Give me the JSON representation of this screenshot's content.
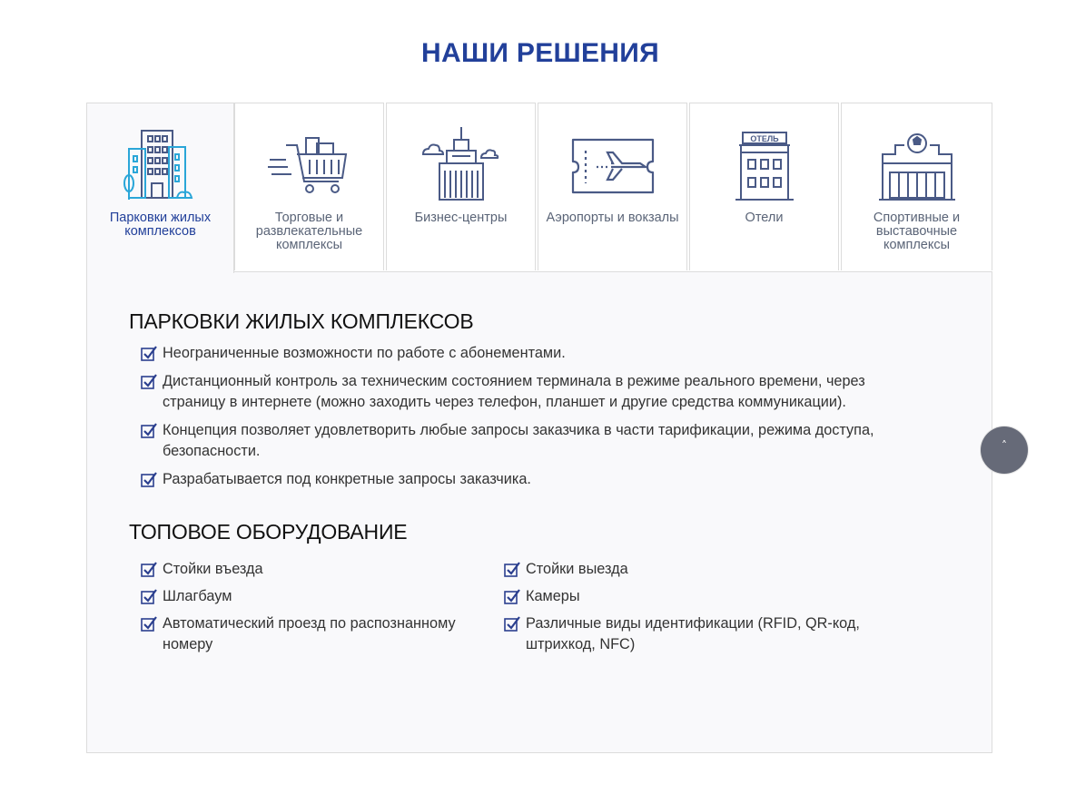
{
  "section_title": "НАШИ РЕШЕНИЯ",
  "tabs": [
    {
      "label": "Парковки жилых комплексов",
      "icon": "residential-building-icon",
      "active": true
    },
    {
      "label": "Торговые и развлекательные комплексы",
      "icon": "shopping-cart-icon",
      "active": false
    },
    {
      "label": "Бизнес-центры",
      "icon": "business-center-icon",
      "active": false
    },
    {
      "label": "Аэропорты и вокзалы",
      "icon": "plane-ticket-icon",
      "active": false
    },
    {
      "label": "Отели",
      "icon": "hotel-icon",
      "active": false,
      "icon_sign": "ОТЕЛЬ"
    },
    {
      "label": "Спортивные и выставочные комплексы",
      "icon": "stadium-icon",
      "active": false
    }
  ],
  "panel": {
    "heading": "ПАРКОВКИ ЖИЛЫХ КОМПЛЕКСОВ",
    "features": [
      "Неограниченные возможности по работе с абонементами.",
      "Дистанционный контроль за техническим состоянием терминала в режиме реального времени, через страницу в интернете (можно заходить через телефон, планшет и другие средства коммуникации).",
      "Концепция позволяет удовлетворить любые запросы заказчика в части тарификации, режима доступа, безопасности.",
      "Разрабатывается под конкретные запросы заказчика."
    ],
    "equipment_heading": "ТОПОВОЕ ОБОРУДОВАНИЕ",
    "equipment_col1": [
      "Стойки въезда",
      "Шлагбаум",
      "Автоматический проезд по распознанному номеру"
    ],
    "equipment_col2": [
      "Стойки выезда",
      "Камеры",
      "Различные виды идентификации (RFID, QR-код, штрихкод, NFC)"
    ]
  },
  "scroll_top": {
    "icon": "chevron-up-icon",
    "glyph": "˄"
  },
  "colors": {
    "title_blue": "#22409a",
    "icon_blue": "#4a5a86",
    "icon_cyan": "#2aa6d8",
    "panel_bg": "#f9f9fb",
    "check_blue": "#2b3f8f"
  }
}
